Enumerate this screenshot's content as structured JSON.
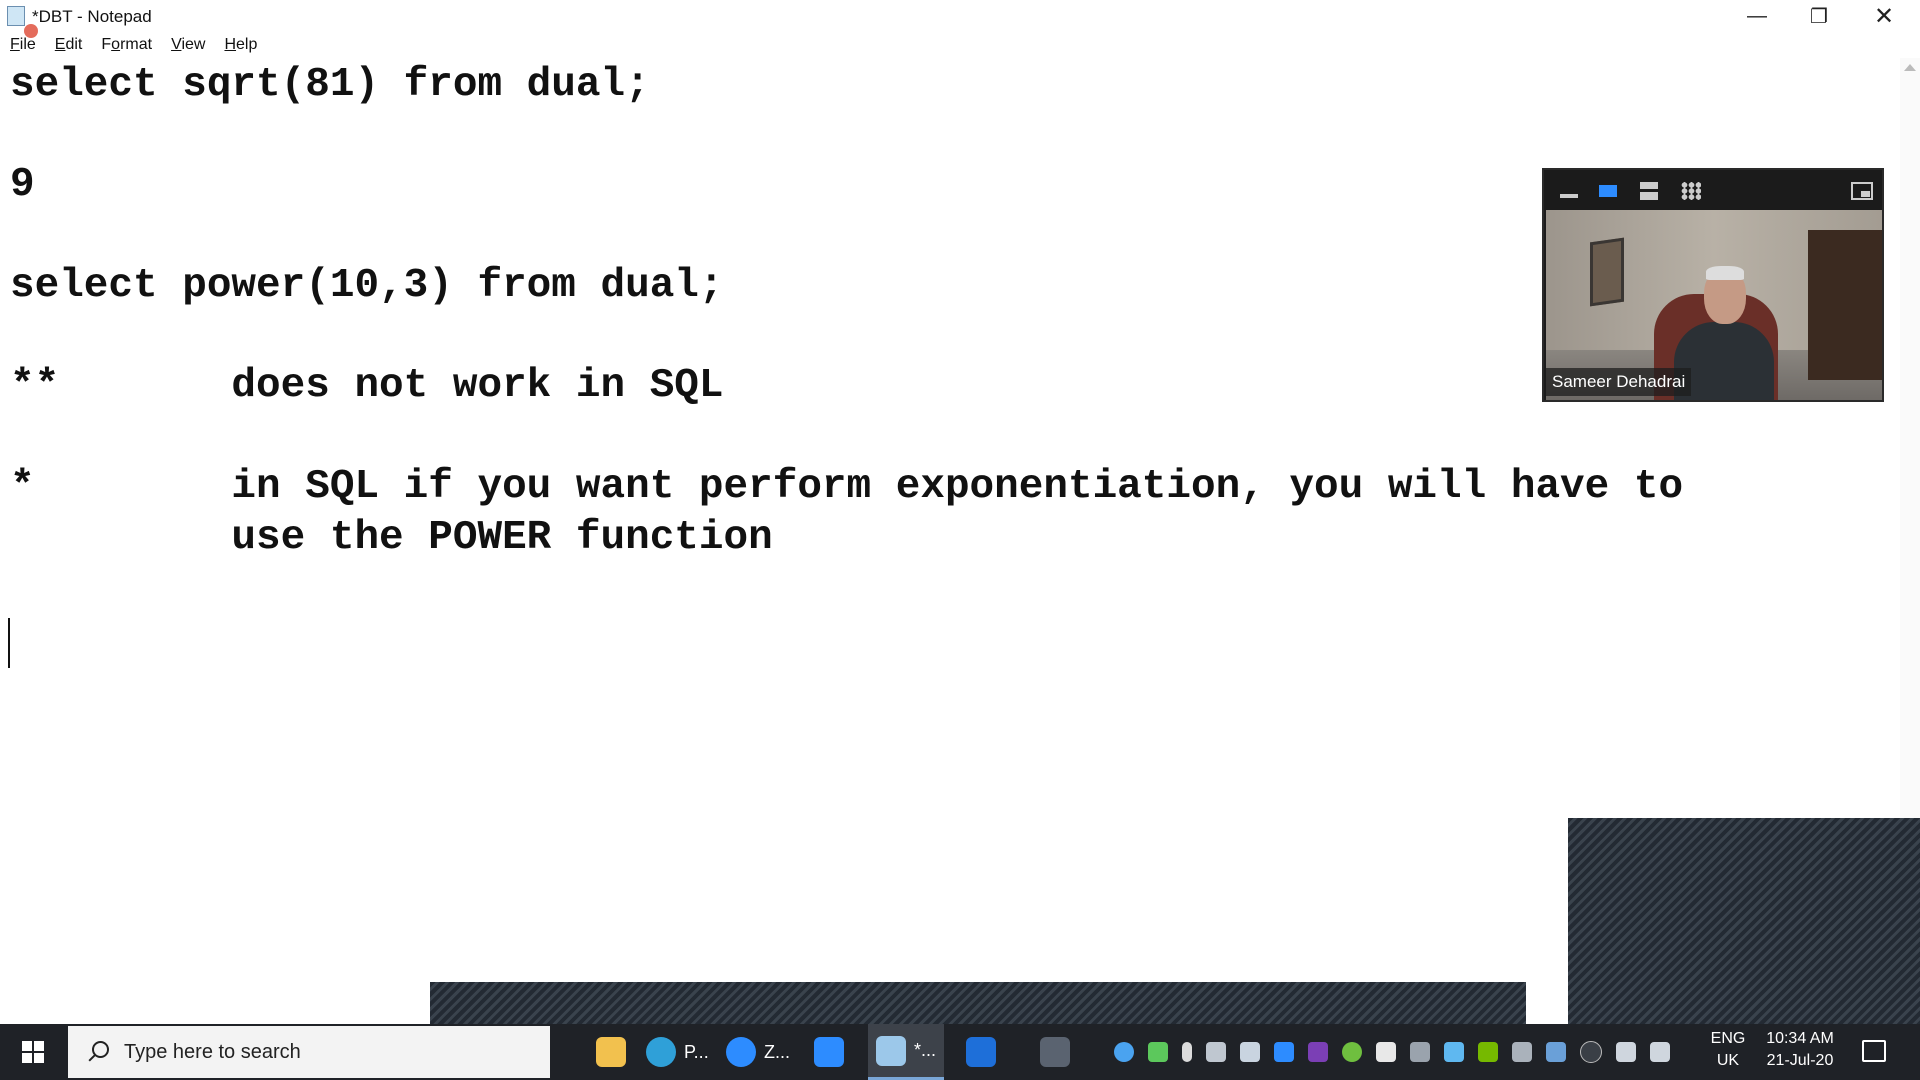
{
  "window": {
    "title": "*DBT - Notepad",
    "controls": {
      "minimize": "—",
      "maximize": "❐",
      "close": "✕"
    }
  },
  "menu": [
    {
      "label": "File",
      "mnemonic": "F",
      "rest": "ile"
    },
    {
      "label": "Edit",
      "mnemonic": "E",
      "rest": "dit"
    },
    {
      "label": "Format",
      "mnemonic": "o",
      "pre": "F",
      "rest": "rmat"
    },
    {
      "label": "View",
      "mnemonic": "V",
      "rest": "iew"
    },
    {
      "label": "Help",
      "mnemonic": "H",
      "rest": "elp"
    }
  ],
  "editor": {
    "lines": [
      "select sqrt(81) from dual;",
      "9",
      "select power(10,3) from dual;",
      "**       does not work in SQL",
      "*        in SQL if you want perform exponentiation, you will have to",
      "         use the POWER function"
    ]
  },
  "zoom": {
    "participant_name": "Sameer Dehadrai",
    "active_layout": "speaker-view"
  },
  "taskbar": {
    "search_placeholder": "Type here to search",
    "apps": [
      {
        "name": "file-explorer",
        "label": "",
        "color": "#f2c14e"
      },
      {
        "name": "edge",
        "label": "P...",
        "color": "#2fa0d8"
      },
      {
        "name": "zoom-meetings",
        "label": "Z...",
        "color": "#2d8cff"
      },
      {
        "name": "zoom",
        "label": "",
        "color": "#2d8cff"
      },
      {
        "name": "notepad",
        "label": "*...",
        "color": "#9cc8ea"
      },
      {
        "name": "whiteboard",
        "label": "",
        "color": "#1e6fd9"
      },
      {
        "name": "terminal",
        "label": "",
        "color": "#5a6370"
      }
    ],
    "language": [
      "ENG",
      "UK"
    ],
    "time": "10:34 AM",
    "date": "21-Jul-20"
  }
}
